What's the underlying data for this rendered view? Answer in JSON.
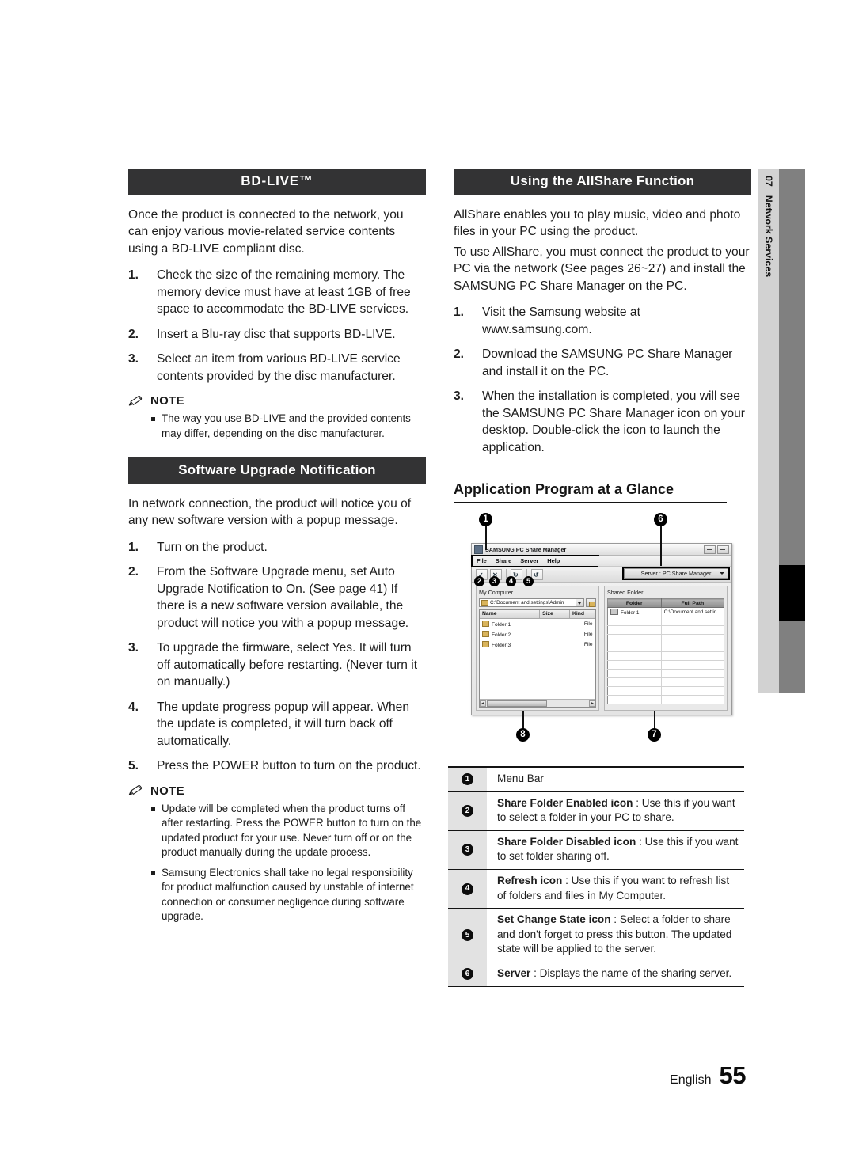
{
  "document": {
    "footer": {
      "language": "English",
      "page_number": "55"
    },
    "side_tab": {
      "chapter_number": "07",
      "chapter_title": "Network Services"
    }
  },
  "left_column": {
    "section1": {
      "heading": "BD-LIVE™",
      "intro": "Once the product is connected to the network, you can enjoy various movie-related service contents using a BD-LIVE compliant disc.",
      "steps": [
        {
          "num": "1.",
          "text": "Check the size of the remaining memory. The memory device must have at least 1GB of free space to accommodate the BD-LIVE services."
        },
        {
          "num": "2.",
          "text": "Insert a Blu-ray disc that supports BD-LIVE."
        },
        {
          "num": "3.",
          "text": "Select an item from various BD-LIVE service contents provided by the disc manufacturer."
        }
      ],
      "note_label": "NOTE",
      "notes": [
        "The way you use BD-LIVE and the provided contents may differ, depending on the disc manufacturer."
      ]
    },
    "section2": {
      "heading": "Software Upgrade Notification",
      "intro": "In network connection, the product will notice you of any new software version with a popup message.",
      "steps": [
        {
          "num": "1.",
          "text": "Turn on the product."
        },
        {
          "num": "2.",
          "text": "From the Software Upgrade menu, set Auto Upgrade Notification to On. (See page 41) If there is a new software version available, the product will notice you with a popup message."
        },
        {
          "num": "3.",
          "text": "To upgrade the firmware, select Yes. It will turn off automatically before restarting. (Never turn it on manually.)"
        },
        {
          "num": "4.",
          "text": "The update progress popup will appear. When the update is completed, it will turn back off automatically."
        },
        {
          "num": "5.",
          "text": "Press the POWER button to turn on the product."
        }
      ],
      "note_label": "NOTE",
      "notes": [
        "Update will be completed when the product turns off after restarting. Press the POWER button to turn on the updated product for your use. Never turn off or on the product manually during the update process.",
        "Samsung Electronics shall take no legal responsibility for product malfunction caused by unstable of internet connection or consumer negligence during software upgrade."
      ]
    }
  },
  "right_column": {
    "heading": "Using the AllShare Function",
    "intro1": "AllShare enables you to play music, video and photo files in your PC using the product.",
    "intro2": "To use AllShare, you must connect the product to your PC via the network (See pages 26~27) and install the SAMSUNG PC Share Manager on the PC.",
    "steps": [
      {
        "num": "1.",
        "text": "Visit the Samsung website at www.samsung.com."
      },
      {
        "num": "2.",
        "text": "Download the SAMSUNG PC Share Manager and install it on the PC."
      },
      {
        "num": "3.",
        "text": "When the installation is completed, you will see the SAMSUNG PC Share Manager icon on your desktop. Double-click the icon to launch the application."
      }
    ],
    "sub_heading": "Application Program at a Glance"
  },
  "app_screenshot": {
    "window_title": "SAMSUNG PC Share Manager",
    "menu_items": [
      "File",
      "Share",
      "Server",
      "Help"
    ],
    "server_combo": "Server : PC Share Manager",
    "left_pane": {
      "title": "My Computer",
      "path": "C:\\Document and settings\\Admin",
      "columns": [
        "Name",
        "Size",
        "Kind"
      ],
      "rows": [
        {
          "name": "Folder 1",
          "size": "",
          "kind": "File"
        },
        {
          "name": "Folder 2",
          "size": "",
          "kind": "File"
        },
        {
          "name": "Folder 3",
          "size": "",
          "kind": "File"
        }
      ]
    },
    "right_pane": {
      "title": "Shared Folder",
      "columns": [
        "Folder",
        "Full Path"
      ],
      "rows": [
        {
          "folder": "Folder 1",
          "full_path": "C:\\Document and settin.."
        }
      ]
    },
    "callouts": [
      "1",
      "2",
      "3",
      "4",
      "5",
      "6",
      "7",
      "8"
    ]
  },
  "legend": {
    "rows": [
      {
        "num": "1",
        "bold": "",
        "text": "Menu Bar"
      },
      {
        "num": "2",
        "bold": "Share Folder Enabled icon",
        "text": " : Use this if you want to select a folder in your PC to share."
      },
      {
        "num": "3",
        "bold": "Share Folder Disabled icon",
        "text": " : Use this if you want to set folder sharing off."
      },
      {
        "num": "4",
        "bold": "Refresh icon",
        "text": " : Use this if you want to refresh list of folders and files in My Computer."
      },
      {
        "num": "5",
        "bold": "Set Change State icon",
        "text": " : Select a folder to share and don't forget to press this button. The updated state will be applied to the server."
      },
      {
        "num": "6",
        "bold": "Server",
        "text": " : Displays the name of the sharing server."
      }
    ]
  }
}
